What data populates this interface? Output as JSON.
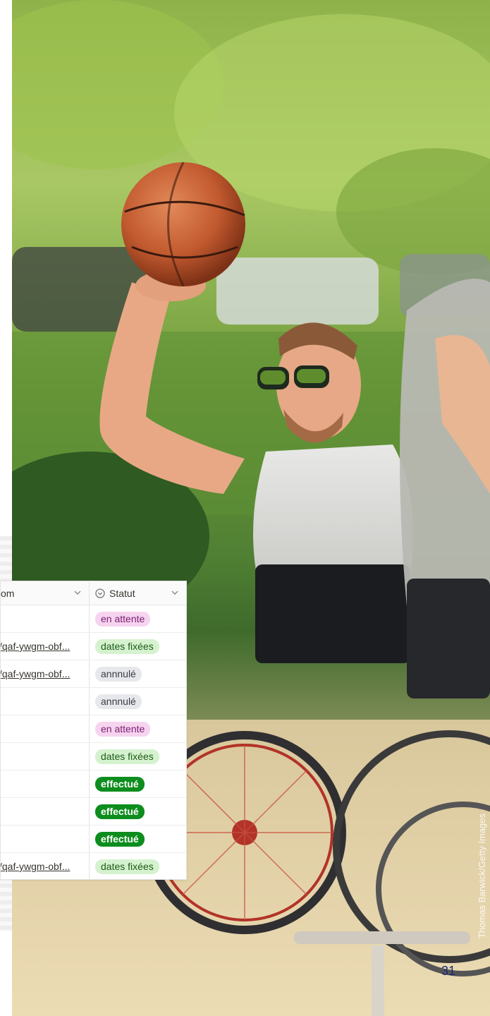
{
  "table": {
    "columns": [
      {
        "label": "om"
      },
      {
        "label": "Statut"
      }
    ],
    "rows": [
      {
        "link": "",
        "status": "en attente",
        "status_kind": "attente"
      },
      {
        "link": "/qaf-ywgm-obf...",
        "status": "dates fixées",
        "status_kind": "fixees"
      },
      {
        "link": "/qaf-ywgm-obf...",
        "status": "annnulé",
        "status_kind": "annule"
      },
      {
        "link": "",
        "status": "annnulé",
        "status_kind": "annule"
      },
      {
        "link": "",
        "status": "en attente",
        "status_kind": "attente"
      },
      {
        "link": "",
        "status": "dates fixées",
        "status_kind": "fixees"
      },
      {
        "link": "",
        "status": "effectué",
        "status_kind": "effectue"
      },
      {
        "link": "",
        "status": "effectué",
        "status_kind": "effectue"
      },
      {
        "link": "",
        "status": "effectué",
        "status_kind": "effectue"
      },
      {
        "link": "/qaf-ywgm-obf...",
        "status": "dates fixées",
        "status_kind": "fixees"
      }
    ]
  },
  "photo": {
    "credit": "Thomas Barwick/Getty Images"
  },
  "slide": {
    "page_number": "31"
  },
  "icons": {
    "status_header": "status-circle-icon",
    "dropdown": "chevron-down-icon"
  },
  "colors": {
    "attente_bg": "#f6d4f0",
    "fixees_bg": "#d5f2cf",
    "annule_bg": "#e7e8ec",
    "effectue_bg": "#0d8d1d",
    "page_number": "#1b2a74"
  }
}
